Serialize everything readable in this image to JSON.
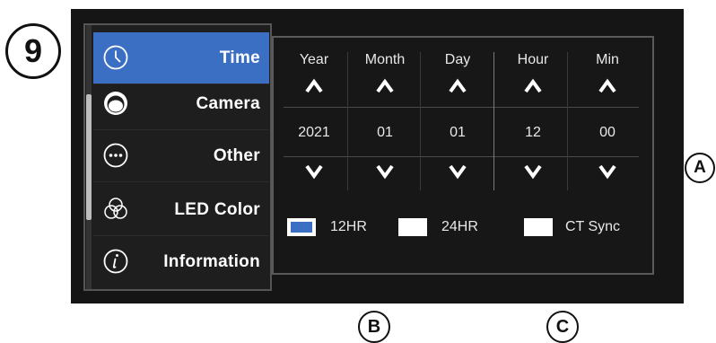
{
  "callouts": {
    "step": "9",
    "a": "A",
    "b": "B",
    "c": "C"
  },
  "sidebar": {
    "items": [
      {
        "label": "Time",
        "icon": "clock-icon",
        "active": true
      },
      {
        "label": "Camera",
        "icon": "camera-icon",
        "active": false
      },
      {
        "label": "Other",
        "icon": "more-dots-icon",
        "active": false
      },
      {
        "label": "LED Color",
        "icon": "color-circles-icon",
        "active": false
      },
      {
        "label": "Information",
        "icon": "info-icon",
        "active": false
      }
    ]
  },
  "time_panel": {
    "columns": [
      {
        "header": "Year",
        "value": "2021"
      },
      {
        "header": "Month",
        "value": "01"
      },
      {
        "header": "Day",
        "value": "01"
      },
      {
        "header": "Hour",
        "value": "12"
      },
      {
        "header": "Min",
        "value": "00"
      }
    ],
    "options": [
      {
        "label": "12HR",
        "checked": true
      },
      {
        "label": "24HR",
        "checked": false
      },
      {
        "label": "CT Sync",
        "checked": false
      }
    ]
  },
  "colors": {
    "accent": "#3b6fc4",
    "screen_bg": "#151515",
    "text": "#e8e8e8"
  }
}
